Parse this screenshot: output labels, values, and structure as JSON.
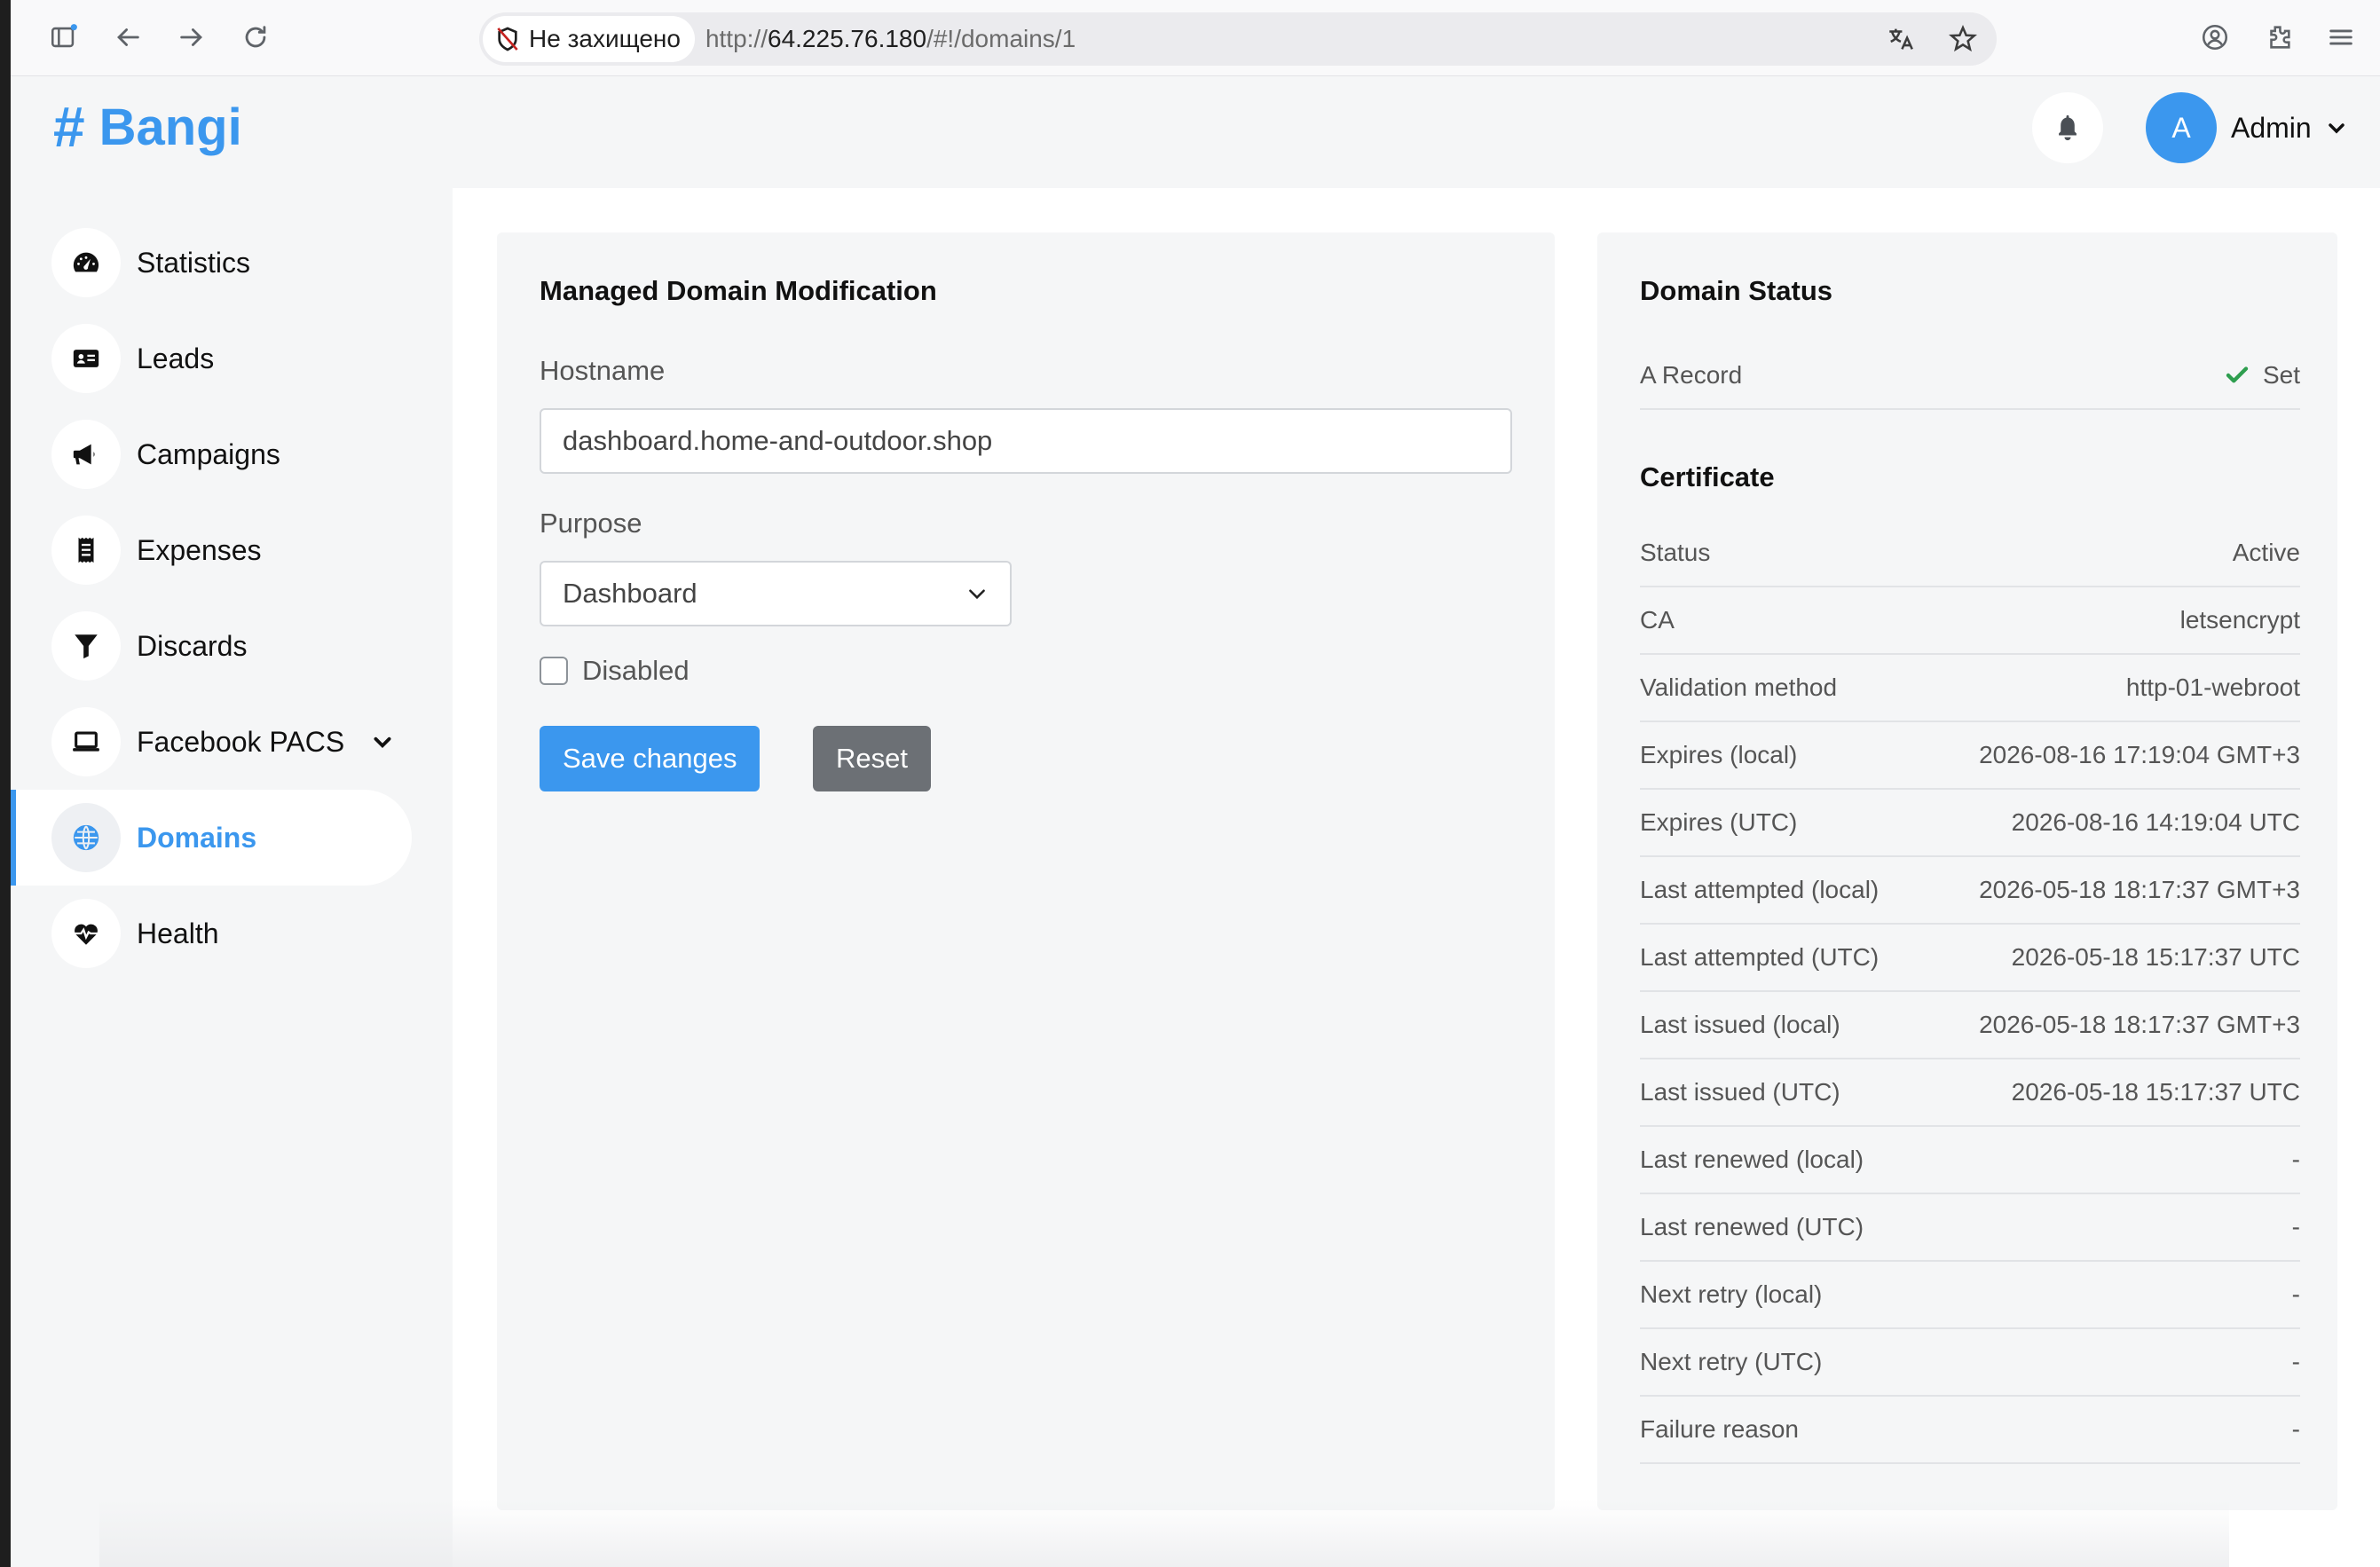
{
  "browser": {
    "security_label": "Не захищено",
    "url_scheme": "http://",
    "url_host": "64.225.76.180",
    "url_path": "/#!/domains/1"
  },
  "header": {
    "logo_hash": "#",
    "logo_text": "Bangi",
    "avatar_letter": "A",
    "user_name": "Admin"
  },
  "sidebar": {
    "items": [
      {
        "label": "Statistics",
        "icon": "gauge-icon"
      },
      {
        "label": "Leads",
        "icon": "id-card-icon"
      },
      {
        "label": "Campaigns",
        "icon": "megaphone-icon"
      },
      {
        "label": "Expenses",
        "icon": "receipt-icon"
      },
      {
        "label": "Discards",
        "icon": "filter-icon"
      },
      {
        "label": "Facebook PACS",
        "icon": "laptop-icon"
      },
      {
        "label": "Domains",
        "icon": "globe-icon"
      },
      {
        "label": "Health",
        "icon": "heartbeat-icon"
      }
    ],
    "active": "Domains"
  },
  "edit_card": {
    "title": "Managed Domain Modification",
    "hostname_label": "Hostname",
    "hostname_value": "dashboard.home-and-outdoor.shop",
    "purpose_label": "Purpose",
    "purpose_value": "Dashboard",
    "disabled_label": "Disabled",
    "save_label": "Save changes",
    "reset_label": "Reset"
  },
  "status_card": {
    "title": "Domain Status",
    "a_record_label": "A Record",
    "a_record_value": "Set",
    "certificate_title": "Certificate",
    "rows": [
      {
        "label": "Status",
        "value": "Active"
      },
      {
        "label": "CA",
        "value": "letsencrypt"
      },
      {
        "label": "Validation method",
        "value": "http-01-webroot"
      },
      {
        "label": "Expires (local)",
        "value": "2026-08-16 17:19:04 GMT+3"
      },
      {
        "label": "Expires (UTC)",
        "value": "2026-08-16 14:19:04 UTC"
      },
      {
        "label": "Last attempted (local)",
        "value": "2026-05-18 18:17:37 GMT+3"
      },
      {
        "label": "Last attempted (UTC)",
        "value": "2026-05-18 15:17:37 UTC"
      },
      {
        "label": "Last issued (local)",
        "value": "2026-05-18 18:17:37 GMT+3"
      },
      {
        "label": "Last issued (UTC)",
        "value": "2026-05-18 15:17:37 UTC"
      },
      {
        "label": "Last renewed (local)",
        "value": "-"
      },
      {
        "label": "Last renewed (UTC)",
        "value": "-"
      },
      {
        "label": "Next retry (local)",
        "value": "-"
      },
      {
        "label": "Next retry (UTC)",
        "value": "-"
      },
      {
        "label": "Failure reason",
        "value": "-"
      }
    ]
  },
  "colors": {
    "accent": "#3b97ee",
    "success": "#2e9e4f",
    "secondary_button": "#6c7075"
  }
}
